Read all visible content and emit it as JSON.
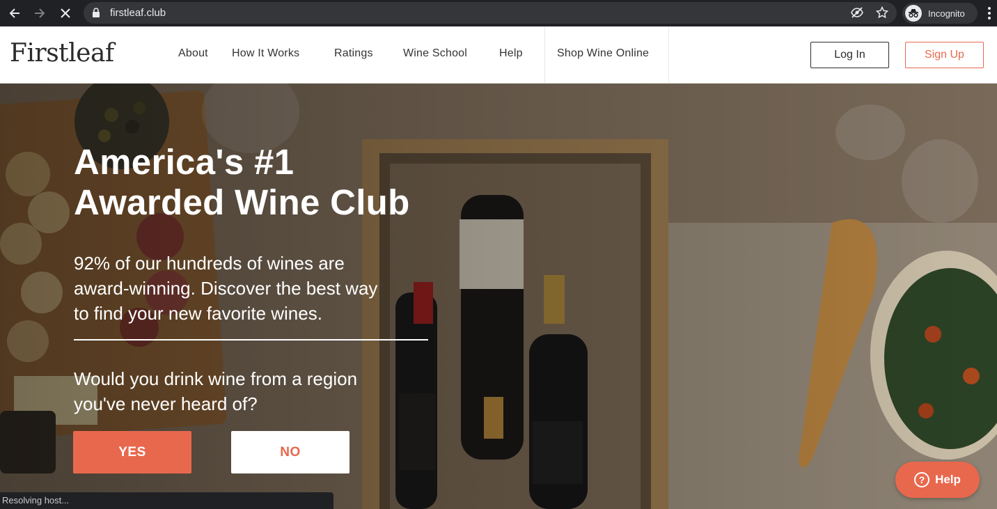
{
  "browser": {
    "url": "firstleaf.club",
    "profile_label": "Incognito",
    "status_text": "Resolving host..."
  },
  "header": {
    "logo": "Firstleaf",
    "nav": [
      "About",
      "How It Works",
      "Ratings",
      "Wine School",
      "Help",
      "Shop Wine Online"
    ],
    "login_label": "Log In",
    "signup_label": "Sign Up"
  },
  "hero": {
    "title_line1": "America's #1",
    "title_line2": "Awarded Wine Club",
    "lead_line1": "92% of our hundreds of wines are",
    "lead_line2": "award-winning. Discover the best way",
    "lead_line3": "to find your new favorite wines.",
    "question_line1": "Would you drink wine from a region",
    "question_line2": "you've never heard of?",
    "yes_label": "YES",
    "no_label": "NO"
  },
  "help_widget": {
    "label": "Help"
  },
  "colors": {
    "accent": "#e8684e",
    "chrome": "#202124",
    "text_dark": "#2b2b2b"
  }
}
